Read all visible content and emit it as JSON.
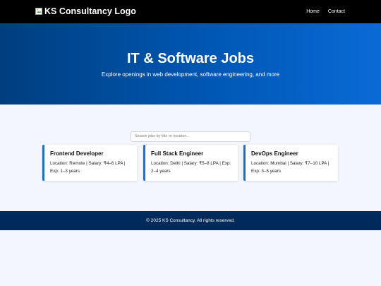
{
  "header": {
    "logo_alt": "KS Consultancy Logo",
    "nav": [
      {
        "label": "Home"
      },
      {
        "label": "Contact"
      }
    ]
  },
  "hero": {
    "title": "IT & Software Jobs",
    "subtitle": "Explore openings in web development, software engineering, and more"
  },
  "search": {
    "placeholder": "Search jobs by title or location...",
    "value": ""
  },
  "jobs": [
    {
      "title": "Frontend Developer",
      "details": "Location: Remote | Salary: ₹4–6 LPA | Exp: 1–3 years"
    },
    {
      "title": "Full Stack Engineer",
      "details": "Location: Delhi | Salary: ₹5–8 LPA | Exp: 2–4 years"
    },
    {
      "title": "DevOps Engineer",
      "details": "Location: Mumbai | Salary: ₹7–10 LPA | Exp: 3–5 years"
    }
  ],
  "footer": {
    "text": "© 2025 KS Consultancy. All rights reserved."
  },
  "colors": {
    "navbar": "#000000",
    "hero_start": "#003e7e",
    "hero_end": "#0a6ad6",
    "card_accent": "#1f6fc2",
    "footer": "#002a5a",
    "page_bg": "#f3f6fc"
  },
  "icons": {
    "logo": "broken-image-icon"
  }
}
